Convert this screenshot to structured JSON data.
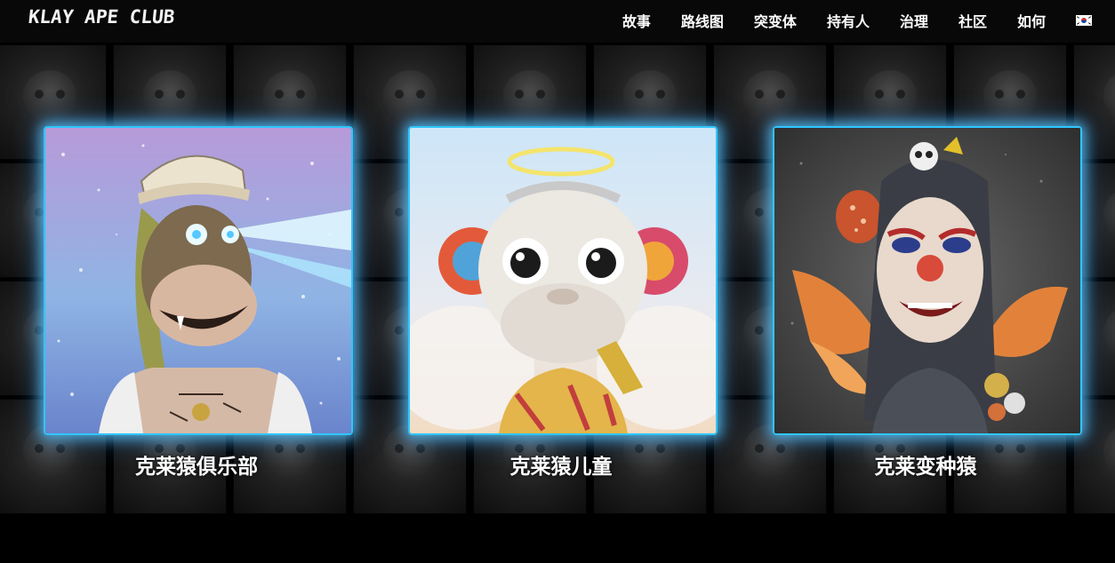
{
  "header": {
    "logo": "KLAY APE CLUB",
    "nav": [
      "故事",
      "路线图",
      "突变体",
      "持有人",
      "治理",
      "社区",
      "如何"
    ],
    "language_flag": "korea-flag-icon"
  },
  "collections": [
    {
      "title": "克莱猿俱乐部",
      "image": "ape-laser-eyes-cap"
    },
    {
      "title": "克莱猿儿童",
      "image": "baby-ape-halo-wings"
    },
    {
      "title": "克莱变种猿",
      "image": "mutant-ape-butterfly-wings"
    }
  ],
  "colors": {
    "accent_glow": "#2fc6ff",
    "background": "#000000",
    "text": "#ffffff"
  }
}
